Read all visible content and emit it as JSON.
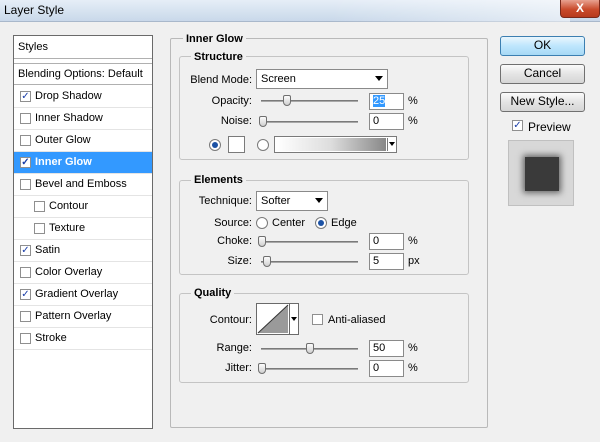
{
  "window": {
    "title": "Layer Style",
    "close_glyph": "X"
  },
  "styles_panel": {
    "header": "Styles",
    "blending": "Blending Options: Default",
    "items": [
      {
        "label": "Drop Shadow",
        "checked": true,
        "selected": false,
        "indent": false
      },
      {
        "label": "Inner Shadow",
        "checked": false,
        "selected": false,
        "indent": false
      },
      {
        "label": "Outer Glow",
        "checked": false,
        "selected": false,
        "indent": false
      },
      {
        "label": "Inner Glow",
        "checked": true,
        "selected": true,
        "indent": false
      },
      {
        "label": "Bevel and Emboss",
        "checked": false,
        "selected": false,
        "indent": false
      },
      {
        "label": "Contour",
        "checked": false,
        "selected": false,
        "indent": true
      },
      {
        "label": "Texture",
        "checked": false,
        "selected": false,
        "indent": true
      },
      {
        "label": "Satin",
        "checked": true,
        "selected": false,
        "indent": false
      },
      {
        "label": "Color Overlay",
        "checked": false,
        "selected": false,
        "indent": false
      },
      {
        "label": "Gradient Overlay",
        "checked": true,
        "selected": false,
        "indent": false
      },
      {
        "label": "Pattern Overlay",
        "checked": false,
        "selected": false,
        "indent": false
      },
      {
        "label": "Stroke",
        "checked": false,
        "selected": false,
        "indent": false
      }
    ]
  },
  "inner_glow": {
    "title": "Inner Glow",
    "structure": {
      "title": "Structure",
      "blend_mode_label": "Blend Mode:",
      "blend_mode_value": "Screen",
      "opacity_label": "Opacity:",
      "opacity_value": "25",
      "opacity_unit": "%",
      "noise_label": "Noise:",
      "noise_value": "0",
      "noise_unit": "%"
    },
    "elements": {
      "title": "Elements",
      "technique_label": "Technique:",
      "technique_value": "Softer",
      "source_label": "Source:",
      "source_center": "Center",
      "source_edge": "Edge",
      "choke_label": "Choke:",
      "choke_value": "0",
      "choke_unit": "%",
      "size_label": "Size:",
      "size_value": "5",
      "size_unit": "px"
    },
    "quality": {
      "title": "Quality",
      "contour_label": "Contour:",
      "antialiased_label": "Anti-aliased",
      "range_label": "Range:",
      "range_value": "50",
      "range_unit": "%",
      "jitter_label": "Jitter:",
      "jitter_value": "0",
      "jitter_unit": "%"
    }
  },
  "buttons": {
    "ok": "OK",
    "cancel": "Cancel",
    "new_style": "New Style...",
    "preview": "Preview"
  },
  "colors": {
    "selection": "#3399ff",
    "accent": "#3c7fb1",
    "close": "#c94b2c"
  }
}
